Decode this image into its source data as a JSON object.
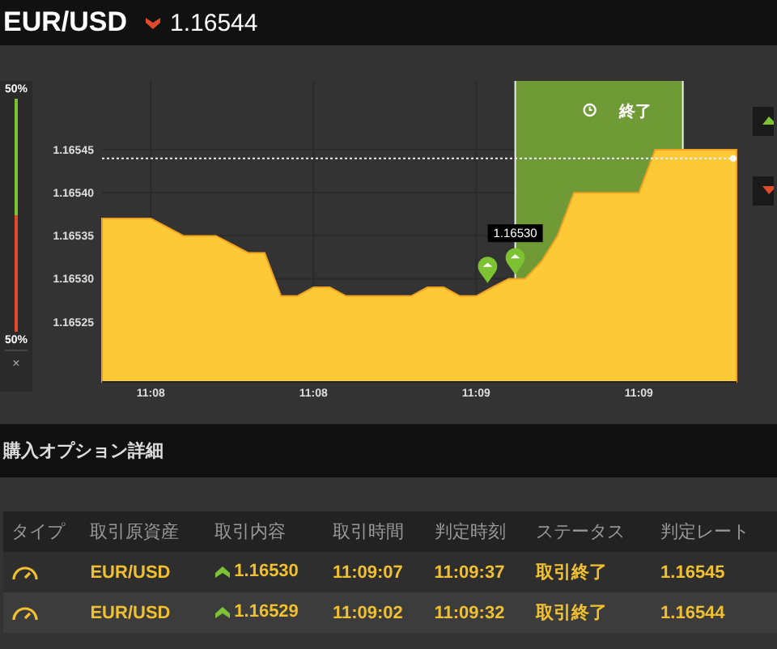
{
  "header": {
    "symbol": "EUR/USD",
    "falling": true,
    "rate": "1.16544"
  },
  "ratio_panel": {
    "top_label": "50%",
    "level": 0.5,
    "bottom_label": "50%",
    "close": "×"
  },
  "chart": {
    "expiry_label": "終了",
    "tooltip": "1.16530",
    "chart_data": {
      "type": "area",
      "grid": true,
      "ref_lines": [
        {
          "axis": "y",
          "value": 1.16544
        }
      ],
      "categories": [
        null,
        null,
        null,
        "11:08",
        null,
        null,
        null,
        null,
        null,
        null,
        null,
        null,
        null,
        "11:08",
        null,
        null,
        null,
        null,
        null,
        null,
        null,
        null,
        null,
        "11:09",
        null,
        null,
        null,
        null,
        null,
        null,
        null,
        null,
        null,
        "11:09",
        null,
        null,
        null,
        null,
        null,
        null
      ],
      "series": [
        {
          "color": "#fdc937",
          "values": [
            1.16537,
            1.16537,
            1.16537,
            1.16537,
            1.16536,
            1.16535,
            1.16535,
            1.16535,
            1.16534,
            1.16533,
            1.16533,
            1.16528,
            1.16528,
            1.16529,
            1.16529,
            1.16528,
            1.16528,
            1.16528,
            1.16528,
            1.16528,
            1.16529,
            1.16529,
            1.16528,
            1.16528,
            1.16529,
            1.1653,
            1.1653,
            1.16532,
            1.16535,
            1.1654,
            1.1654,
            1.1654,
            1.1654,
            1.1654,
            1.16545,
            1.16545,
            1.16545,
            1.16545,
            1.16545,
            1.16545
          ]
        }
      ],
      "ylim": [
        1.16518,
        1.16553
      ],
      "yticks": [
        {
          "value": 1.16525,
          "label": "1.16525"
        },
        {
          "value": 1.1653,
          "label": "1.16530"
        },
        {
          "value": 1.16535,
          "label": "1.16535"
        },
        {
          "value": 1.1654,
          "label": "1.16540"
        },
        {
          "value": 1.16545,
          "label": "1.16545"
        }
      ]
    }
  },
  "section_title": "購入オプション詳細",
  "table": {
    "columns": [
      "タイプ",
      "取引原資産",
      "取引内容",
      "取引時間",
      "判定時刻",
      "ステータス",
      "判定レート"
    ],
    "rows": [
      {
        "asset": "EUR/USD",
        "rising": true,
        "entry": "1.16530",
        "trade_time": "11:09:07",
        "judge_time": "11:09:37",
        "status": "取引終了",
        "rate": "1.16545"
      },
      {
        "asset": "EUR/USD",
        "rising": true,
        "entry": "1.16529",
        "trade_time": "11:09:02",
        "judge_time": "11:09:32",
        "status": "取引終了",
        "rate": "1.16544"
      }
    ]
  }
}
